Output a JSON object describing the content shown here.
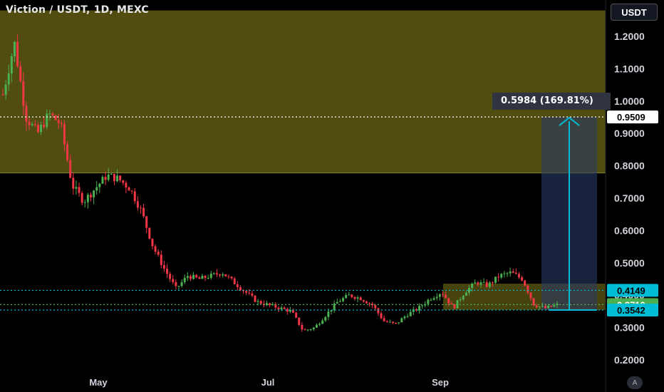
{
  "header": {
    "title": "Viction / USDT, 1D, MEXC"
  },
  "currency_button": {
    "label": "USDT"
  },
  "auto_button": {
    "label": "A"
  },
  "colors": {
    "up": "#26a69a",
    "up_bright": "#4caf50",
    "down": "#f23645",
    "zone": "#5f5a14",
    "target": "#00bcd4",
    "measure_box": "#2a3a66"
  },
  "chart_data": {
    "type": "candlestick",
    "title": "Viction / USDT, 1D, MEXC",
    "y_axis": {
      "ticks": [
        "1.2000",
        "1.1000",
        "1.0000",
        "0.9000",
        "0.8000",
        "0.7000",
        "0.6000",
        "0.5000",
        "0.4000",
        "0.3000",
        "0.2000"
      ],
      "range": [
        0.18,
        1.28
      ]
    },
    "x_axis": {
      "ticks": [
        "May",
        "Jul",
        "Sep"
      ]
    },
    "series": [
      {
        "name": "price_path",
        "points": [
          [
            "start",
            1.02
          ],
          [
            "p1",
            1.18
          ],
          [
            "p2",
            0.95
          ],
          [
            "p3",
            0.9
          ],
          [
            "p4",
            0.96
          ],
          [
            "p5",
            0.93
          ],
          [
            "p6",
            0.74
          ],
          [
            "p7",
            0.69
          ],
          [
            "p8",
            0.73
          ],
          [
            "p9",
            0.77
          ],
          [
            "p10",
            0.76
          ],
          [
            "p11",
            0.73
          ],
          [
            "p12",
            0.66
          ],
          [
            "p13",
            0.55
          ],
          [
            "p14",
            0.48
          ],
          [
            "p15",
            0.42
          ],
          [
            "p16",
            0.46
          ],
          [
            "p17",
            0.45
          ],
          [
            "p18",
            0.46
          ],
          [
            "p19",
            0.47
          ],
          [
            "p20",
            0.44
          ],
          [
            "p21",
            0.41
          ],
          [
            "p22",
            0.38
          ],
          [
            "p23",
            0.37
          ],
          [
            "p24",
            0.36
          ],
          [
            "p25",
            0.35
          ],
          [
            "p26",
            0.29
          ],
          [
            "p27",
            0.3
          ],
          [
            "p28",
            0.34
          ],
          [
            "p29",
            0.38
          ],
          [
            "p30",
            0.4
          ],
          [
            "p31",
            0.39
          ],
          [
            "p32",
            0.37
          ],
          [
            "p33",
            0.32
          ],
          [
            "p34",
            0.31
          ],
          [
            "p35",
            0.34
          ],
          [
            "p36",
            0.36
          ],
          [
            "p37",
            0.39
          ],
          [
            "p38",
            0.41
          ],
          [
            "p39",
            0.36
          ],
          [
            "p40",
            0.41
          ],
          [
            "p41",
            0.44
          ],
          [
            "p42",
            0.43
          ],
          [
            "p43",
            0.46
          ],
          [
            "p44",
            0.47
          ],
          [
            "p45",
            0.45
          ],
          [
            "p46",
            0.37
          ],
          [
            "p47",
            0.36
          ],
          [
            "p48",
            0.37
          ]
        ]
      }
    ],
    "levels": [
      {
        "name": "target",
        "value": 0.9509,
        "label": "0.9509"
      },
      {
        "name": "resistance",
        "value": 0.4149,
        "label": "0.4149"
      },
      {
        "name": "last_price",
        "value": 0.371,
        "label": "0.3710"
      },
      {
        "name": "support",
        "value": 0.3542,
        "label": "0.3542"
      }
    ],
    "zones": [
      {
        "name": "upper-zone",
        "from": 0.778,
        "to": 1.28
      }
    ],
    "measure": {
      "label": "0.5984 (169.81%)",
      "from": 0.3542,
      "to": 0.9509
    },
    "grid": false
  }
}
